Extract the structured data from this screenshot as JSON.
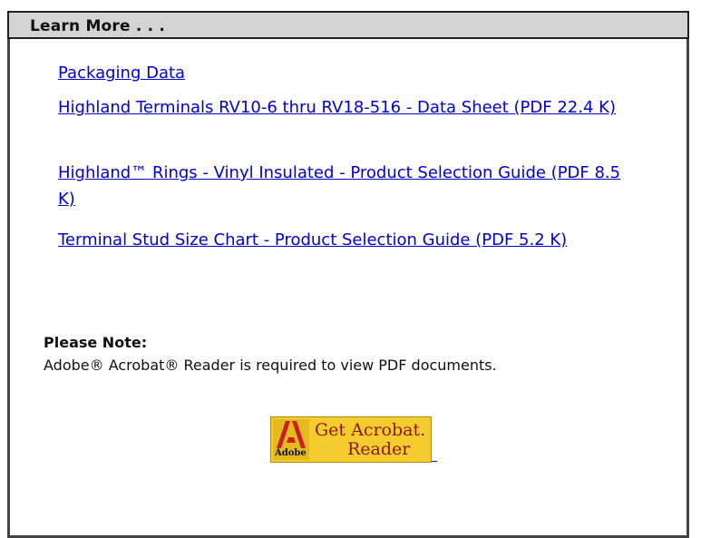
{
  "header": {
    "title": "Learn More . . ."
  },
  "links": [
    {
      "label": "Packaging Data"
    },
    {
      "label": "Highland Terminals RV10-6 thru RV18-516 - Data Sheet (PDF 22.4 K)"
    },
    {
      "label": "Highland™ Rings - Vinyl Insulated - Product Selection Guide (PDF 8.5 K)"
    },
    {
      "label": "Terminal Stud Size Chart - Product Selection Guide (PDF 5.2 K)"
    }
  ],
  "note": {
    "title": "Please Note:",
    "text": "Adobe® Acrobat® Reader is required to view PDF documents."
  },
  "acrobat_badge": {
    "line1": "Get Acrobat.",
    "line2": "Reader",
    "brand": "Adobe",
    "icon": "adobe-logo-icon",
    "colors": {
      "background": "#f4cc30",
      "logo_red": "#cc1f1f",
      "text": "#8b1a12"
    }
  },
  "colors": {
    "link": "#0000cc",
    "header_bg": "#d4d4d4"
  }
}
